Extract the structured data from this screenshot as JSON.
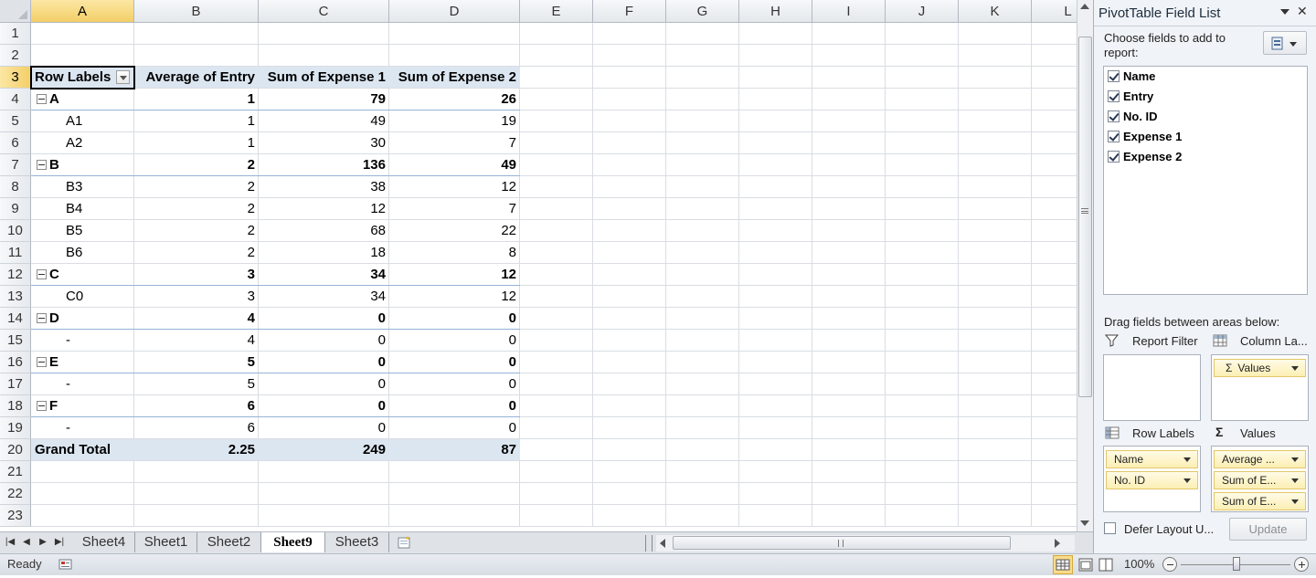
{
  "columns": [
    {
      "label": "A",
      "w": 113
    },
    {
      "label": "B",
      "w": 136
    },
    {
      "label": "C",
      "w": 143
    },
    {
      "label": "D",
      "w": 143
    },
    {
      "label": "E",
      "w": 80
    },
    {
      "label": "F",
      "w": 80
    },
    {
      "label": "G",
      "w": 80
    },
    {
      "label": "H",
      "w": 80
    },
    {
      "label": "I",
      "w": 80
    },
    {
      "label": "J",
      "w": 80
    },
    {
      "label": "K",
      "w": 80
    },
    {
      "label": "L",
      "w": 80
    }
  ],
  "rows": [
    "1",
    "2",
    "3",
    "4",
    "5",
    "6",
    "7",
    "8",
    "9",
    "10",
    "11",
    "12",
    "13",
    "14",
    "15",
    "16",
    "17",
    "18",
    "19",
    "20",
    "21",
    "22",
    "23"
  ],
  "pivot": {
    "headers": [
      "Row Labels",
      "Average of Entry",
      "Sum of Expense 1",
      "Sum of Expense 2"
    ],
    "body": [
      {
        "label": "A",
        "v": [
          "1",
          "79",
          "26"
        ],
        "group": true
      },
      {
        "label": "A1",
        "v": [
          "1",
          "49",
          "19"
        ],
        "group": false
      },
      {
        "label": "A2",
        "v": [
          "1",
          "30",
          "7"
        ],
        "group": false
      },
      {
        "label": "B",
        "v": [
          "2",
          "136",
          "49"
        ],
        "group": true
      },
      {
        "label": "B3",
        "v": [
          "2",
          "38",
          "12"
        ],
        "group": false
      },
      {
        "label": "B4",
        "v": [
          "2",
          "12",
          "7"
        ],
        "group": false
      },
      {
        "label": "B5",
        "v": [
          "2",
          "68",
          "22"
        ],
        "group": false
      },
      {
        "label": "B6",
        "v": [
          "2",
          "18",
          "8"
        ],
        "group": false
      },
      {
        "label": "C",
        "v": [
          "3",
          "34",
          "12"
        ],
        "group": true
      },
      {
        "label": "C0",
        "v": [
          "3",
          "34",
          "12"
        ],
        "group": false
      },
      {
        "label": "D",
        "v": [
          "4",
          "0",
          "0"
        ],
        "group": true
      },
      {
        "label": "-",
        "v": [
          "4",
          "0",
          "0"
        ],
        "group": false
      },
      {
        "label": "E",
        "v": [
          "5",
          "0",
          "0"
        ],
        "group": true
      },
      {
        "label": "-",
        "v": [
          "5",
          "0",
          "0"
        ],
        "group": false
      },
      {
        "label": "F",
        "v": [
          "6",
          "0",
          "0"
        ],
        "group": true
      },
      {
        "label": "-",
        "v": [
          "6",
          "0",
          "0"
        ],
        "group": false
      }
    ],
    "grand": {
      "label": "Grand Total",
      "v": [
        "2.25",
        "249",
        "87"
      ]
    }
  },
  "sheets": [
    "Sheet4",
    "Sheet1",
    "Sheet2",
    "Sheet9",
    "Sheet3"
  ],
  "active_sheet": "Sheet9",
  "status": {
    "ready": "Ready",
    "zoom": "100%"
  },
  "pane": {
    "title": "PivotTable Field List",
    "choose_label": "Choose fields to add to report:",
    "fields": [
      {
        "name": "Name",
        "checked": true
      },
      {
        "name": "Entry",
        "checked": true
      },
      {
        "name": "No. ID",
        "checked": true
      },
      {
        "name": "Expense 1",
        "checked": true
      },
      {
        "name": "Expense 2",
        "checked": true
      }
    ],
    "drag_label": "Drag fields between areas below:",
    "report_filter": "Report Filter",
    "column_labels": "Column La...",
    "row_labels": "Row Labels",
    "values_label": "Values",
    "column_items": [
      "Values"
    ],
    "row_items": [
      "Name",
      "No. ID"
    ],
    "value_items": [
      "Average ...",
      "Sum of E...",
      "Sum of E..."
    ],
    "defer_label": "Defer Layout U...",
    "update_label": "Update"
  }
}
